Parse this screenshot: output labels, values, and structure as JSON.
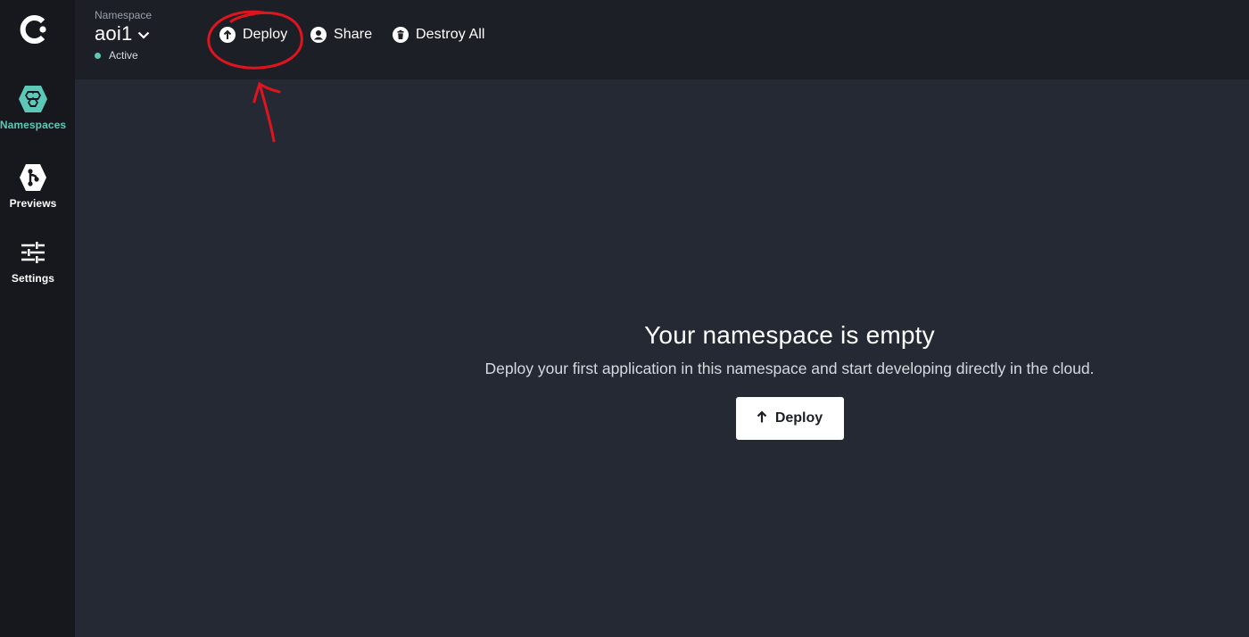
{
  "sidebar": {
    "items": [
      {
        "label": "Namespaces",
        "icon": "namespaces-icon",
        "active": true
      },
      {
        "label": "Previews",
        "icon": "previews-icon",
        "active": false
      },
      {
        "label": "Settings",
        "icon": "settings-icon",
        "active": false
      }
    ]
  },
  "header": {
    "namespace_caption": "Namespace",
    "namespace_name": "aoi1",
    "namespace_status": "Active",
    "deploy_label": "Deploy",
    "share_label": "Share",
    "destroy_label": "Destroy All"
  },
  "empty_state": {
    "title": "Your namespace is empty",
    "description": "Deploy your first application in this namespace and start developing directly in the cloud.",
    "button_label": "Deploy"
  },
  "colors": {
    "accent": "#5ec8b8",
    "annotation": "#e0141e",
    "sidebar_bg": "#16181d",
    "header_bg": "#1c1f26",
    "main_bg": "#252933"
  }
}
